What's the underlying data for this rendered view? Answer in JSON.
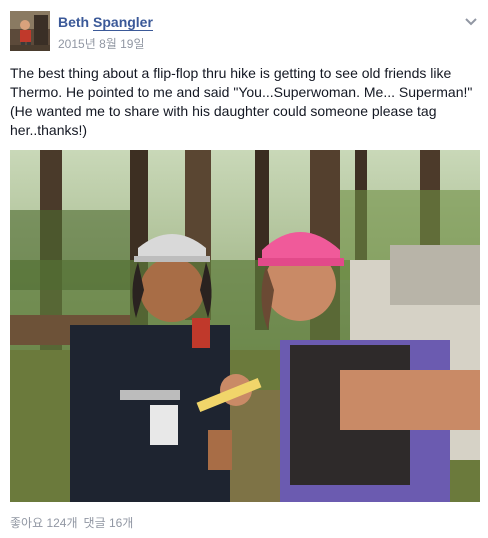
{
  "post": {
    "author": "Beth Spangler",
    "author_first": "Beth",
    "author_last": "Spangler",
    "timestamp": "2015년 8월 19일",
    "text": "The best thing about a flip-flop thru hike is getting to see old friends like Thermo. He pointed to me and said \"You...Superwoman. Me... Superman!\" (He wanted me to share with his daughter could someone please tag her..thanks!)",
    "options_icon": "chevron-down-icon",
    "photo_subject": "two-hikers-selfie-in-forest"
  },
  "footer": {
    "likes": "좋아요 124개",
    "comments": "댓글 16개"
  },
  "colors": {
    "link": "#3b5998",
    "meta": "#9197a3",
    "text": "#141823"
  }
}
